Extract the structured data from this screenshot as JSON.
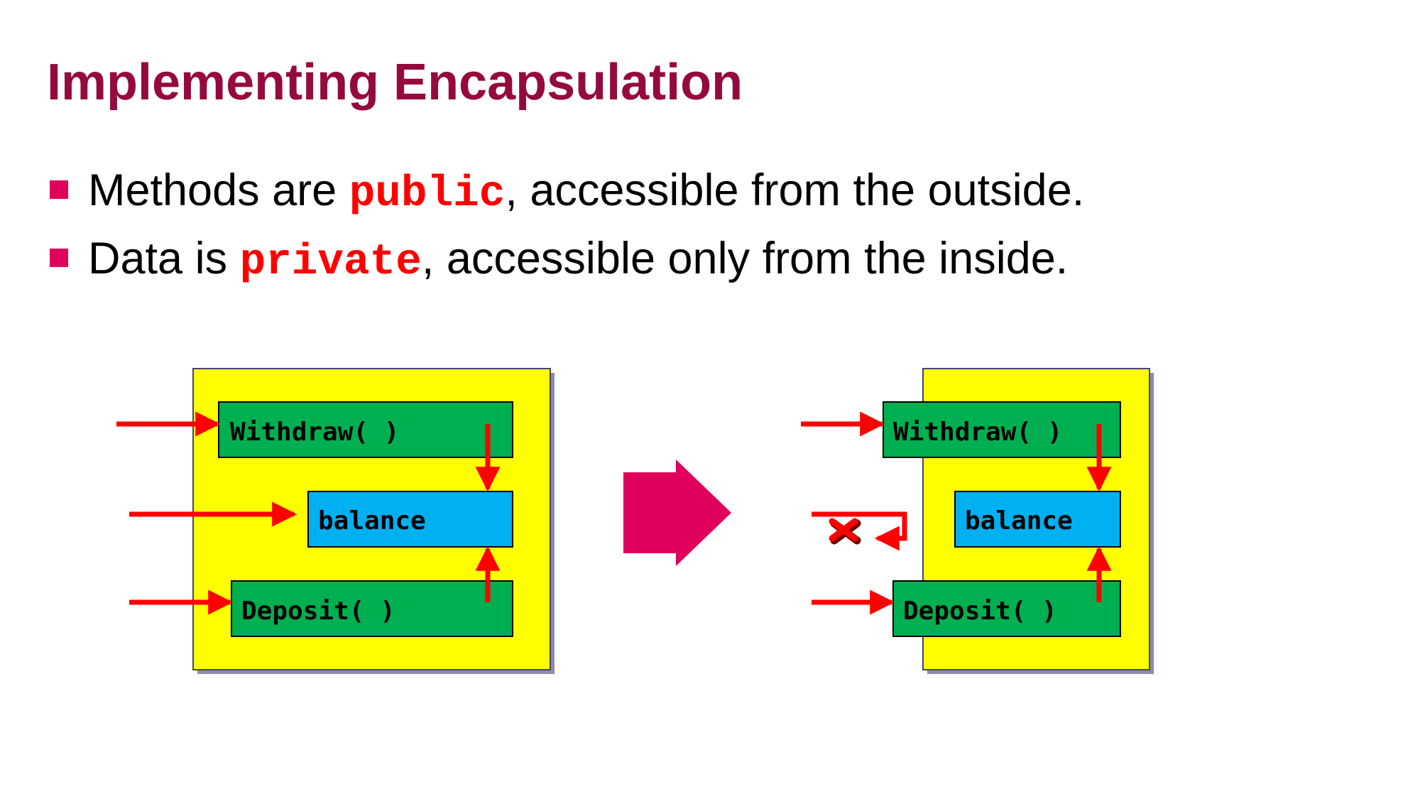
{
  "slide": {
    "title": "Implementing Encapsulation",
    "bullets": [
      {
        "before": "Methods are ",
        "keyword": "public",
        "after": ", accessible from the outside."
      },
      {
        "before": "Data is ",
        "keyword": "private",
        "after": ", accessible only from the inside."
      }
    ]
  },
  "diagram": {
    "before": {
      "method_top": "Withdraw( )",
      "data_field": "balance",
      "method_bottom": "Deposit( )"
    },
    "after": {
      "method_top": "Withdraw( )",
      "data_field": "balance",
      "method_bottom": "Deposit( )",
      "blocked_access_icon": "x-mark-icon"
    },
    "transition_icon": "right-arrow-icon"
  },
  "colors": {
    "title": "#950a3c",
    "bullet_marker": "#e0005c",
    "keyword": "#ff0000",
    "object_fill": "#ffff00",
    "method_fill": "#00b050",
    "data_fill": "#00b0f0",
    "access_arrow": "#ff0000",
    "transition_arrow": "#e0005c"
  }
}
